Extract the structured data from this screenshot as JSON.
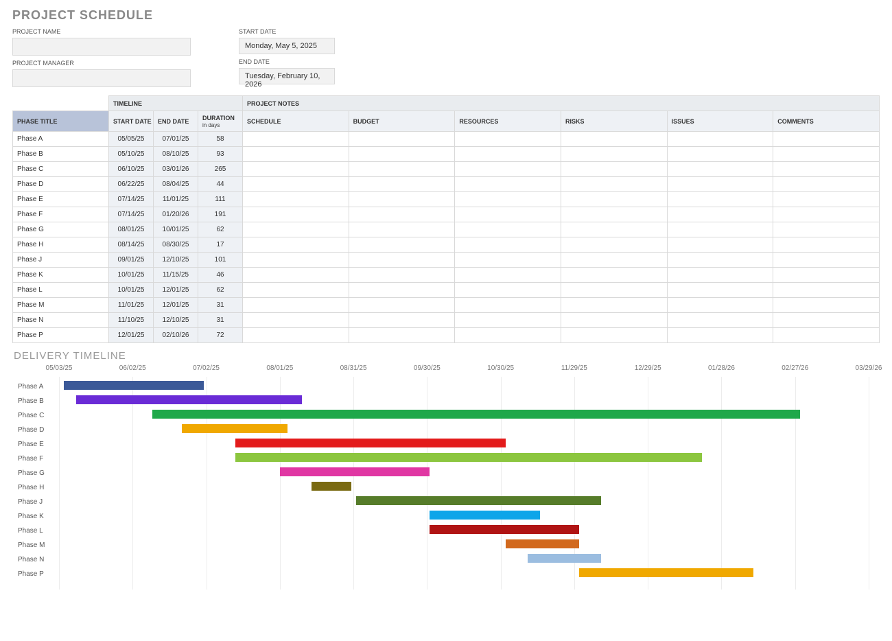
{
  "title": "PROJECT SCHEDULE",
  "header": {
    "project_name_label": "PROJECT NAME",
    "project_name": "",
    "project_manager_label": "PROJECT MANAGER",
    "project_manager": "",
    "start_date_label": "START DATE",
    "start_date": "Monday, May 5, 2025",
    "end_date_label": "END DATE",
    "end_date": "Tuesday, February 10, 2026"
  },
  "table": {
    "timeline_header": "TIMELINE",
    "notes_header": "PROJECT NOTES",
    "phase_title_header": "PHASE TITLE",
    "start_date_header": "START DATE",
    "end_date_header": "END DATE",
    "duration_header": "DURATION",
    "duration_sub": "in days",
    "note_cols": [
      "SCHEDULE",
      "BUDGET",
      "RESOURCES",
      "RISKS",
      "ISSUES",
      "COMMENTS"
    ],
    "rows": [
      {
        "name": "Phase A",
        "start": "05/05/25",
        "end": "07/01/25",
        "dur": "58"
      },
      {
        "name": "Phase B",
        "start": "05/10/25",
        "end": "08/10/25",
        "dur": "93"
      },
      {
        "name": "Phase C",
        "start": "06/10/25",
        "end": "03/01/26",
        "dur": "265"
      },
      {
        "name": "Phase D",
        "start": "06/22/25",
        "end": "08/04/25",
        "dur": "44"
      },
      {
        "name": "Phase E",
        "start": "07/14/25",
        "end": "11/01/25",
        "dur": "111"
      },
      {
        "name": "Phase F",
        "start": "07/14/25",
        "end": "01/20/26",
        "dur": "191"
      },
      {
        "name": "Phase G",
        "start": "08/01/25",
        "end": "10/01/25",
        "dur": "62"
      },
      {
        "name": "Phase H",
        "start": "08/14/25",
        "end": "08/30/25",
        "dur": "17"
      },
      {
        "name": "Phase J",
        "start": "09/01/25",
        "end": "12/10/25",
        "dur": "101"
      },
      {
        "name": "Phase K",
        "start": "10/01/25",
        "end": "11/15/25",
        "dur": "46"
      },
      {
        "name": "Phase L",
        "start": "10/01/25",
        "end": "12/01/25",
        "dur": "62"
      },
      {
        "name": "Phase M",
        "start": "11/01/25",
        "end": "12/01/25",
        "dur": "31"
      },
      {
        "name": "Phase N",
        "start": "11/10/25",
        "end": "12/10/25",
        "dur": "31"
      },
      {
        "name": "Phase P",
        "start": "12/01/25",
        "end": "02/10/26",
        "dur": "72"
      }
    ]
  },
  "delivery_title": "DELIVERY TIMELINE",
  "chart_data": {
    "type": "bar",
    "orientation": "horizontal-gantt",
    "x_axis_ticks": [
      "05/03/25",
      "06/02/25",
      "07/02/25",
      "08/01/25",
      "08/31/25",
      "09/30/25",
      "10/30/25",
      "11/29/25",
      "12/29/25",
      "01/28/26",
      "02/27/26",
      "03/29/26"
    ],
    "series": [
      {
        "name": "Phase A",
        "start": "05/05/25",
        "end": "07/01/25",
        "color": "#3b5998"
      },
      {
        "name": "Phase B",
        "start": "05/10/25",
        "end": "08/10/25",
        "color": "#6a2bd6"
      },
      {
        "name": "Phase C",
        "start": "06/10/25",
        "end": "03/01/26",
        "color": "#1fa84a"
      },
      {
        "name": "Phase D",
        "start": "06/22/25",
        "end": "08/04/25",
        "color": "#f0a800"
      },
      {
        "name": "Phase E",
        "start": "07/14/25",
        "end": "11/01/25",
        "color": "#e31b1b"
      },
      {
        "name": "Phase F",
        "start": "07/14/25",
        "end": "01/20/26",
        "color": "#8cc63f"
      },
      {
        "name": "Phase G",
        "start": "08/01/25",
        "end": "10/01/25",
        "color": "#e037a3"
      },
      {
        "name": "Phase H",
        "start": "08/14/25",
        "end": "08/30/25",
        "color": "#7a6a12"
      },
      {
        "name": "Phase J",
        "start": "09/01/25",
        "end": "12/10/25",
        "color": "#567c2a"
      },
      {
        "name": "Phase K",
        "start": "10/01/25",
        "end": "11/15/25",
        "color": "#0ea5e9"
      },
      {
        "name": "Phase L",
        "start": "10/01/25",
        "end": "12/01/25",
        "color": "#b01414"
      },
      {
        "name": "Phase M",
        "start": "11/01/25",
        "end": "12/01/25",
        "color": "#d2691e"
      },
      {
        "name": "Phase N",
        "start": "11/10/25",
        "end": "12/10/25",
        "color": "#9bbde0"
      },
      {
        "name": "Phase P",
        "start": "12/01/25",
        "end": "02/10/26",
        "color": "#f0a800"
      }
    ]
  }
}
